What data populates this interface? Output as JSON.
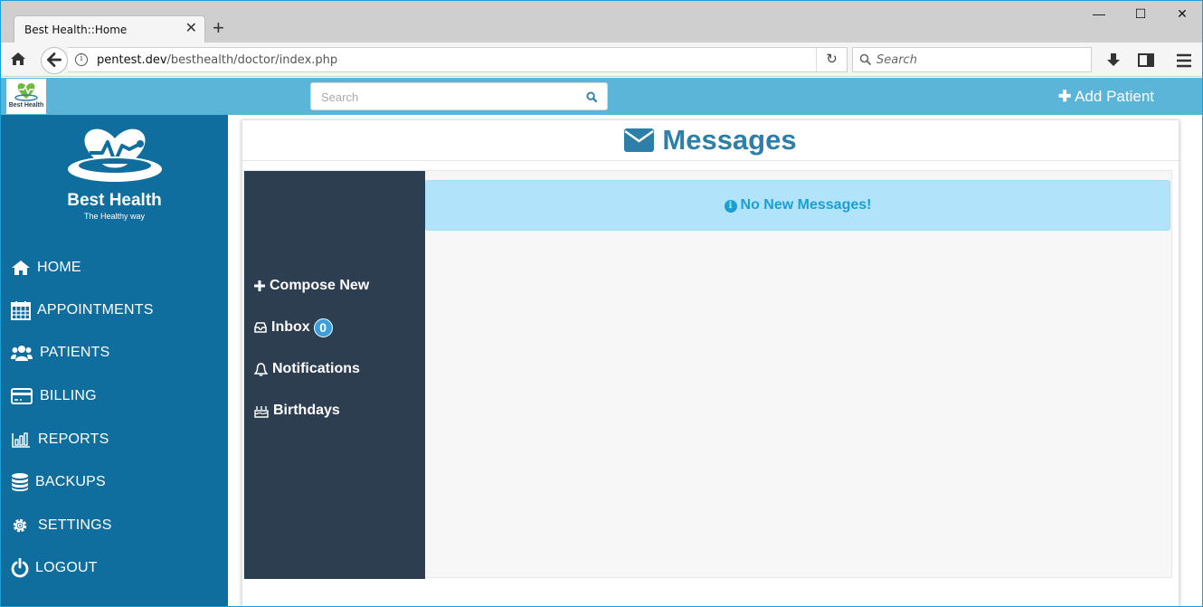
{
  "browser": {
    "tab_title": "Best Health::Home",
    "tab_close": "✕",
    "new_tab": "+",
    "url_host": "pentest.dev",
    "url_path": "/besthealth/doctor/index.php",
    "search_placeholder": "Search",
    "window_controls": {
      "minimize": "—",
      "maximize": "☐",
      "close": "✕"
    }
  },
  "app_header": {
    "search_placeholder": "Search",
    "add_patient_label": "Add Patient",
    "add_patient_icon": "plus-icon"
  },
  "brand": {
    "name": "Best Health",
    "tagline": "The Healthy way",
    "colors": {
      "sidebar": "#0f6e9e",
      "header": "#5ab5d8",
      "nav_dark": "#2d3e50",
      "title": "#2d7fa9"
    }
  },
  "sidebar": {
    "items": [
      {
        "label": "HOME",
        "icon": "home-icon"
      },
      {
        "label": "APPOINTMENTS",
        "icon": "calendar-icon"
      },
      {
        "label": "PATIENTS",
        "icon": "users-icon"
      },
      {
        "label": "BILLING",
        "icon": "credit-card-icon"
      },
      {
        "label": "REPORTS",
        "icon": "bar-chart-icon"
      },
      {
        "label": "BACKUPS",
        "icon": "database-icon"
      },
      {
        "label": "SETTINGS",
        "icon": "gear-icon"
      },
      {
        "label": "LOGOUT",
        "icon": "power-icon"
      }
    ]
  },
  "messages": {
    "title": "Messages",
    "nav": [
      {
        "label": "Compose New",
        "icon": "plus-icon"
      },
      {
        "label": "Inbox",
        "icon": "inbox-icon",
        "badge": "0"
      },
      {
        "label": "Notifications",
        "icon": "bell-icon"
      },
      {
        "label": "Birthdays",
        "icon": "birthday-cake-icon"
      }
    ],
    "alert_text": "No New Messages!",
    "alert_icon": "info-icon"
  }
}
